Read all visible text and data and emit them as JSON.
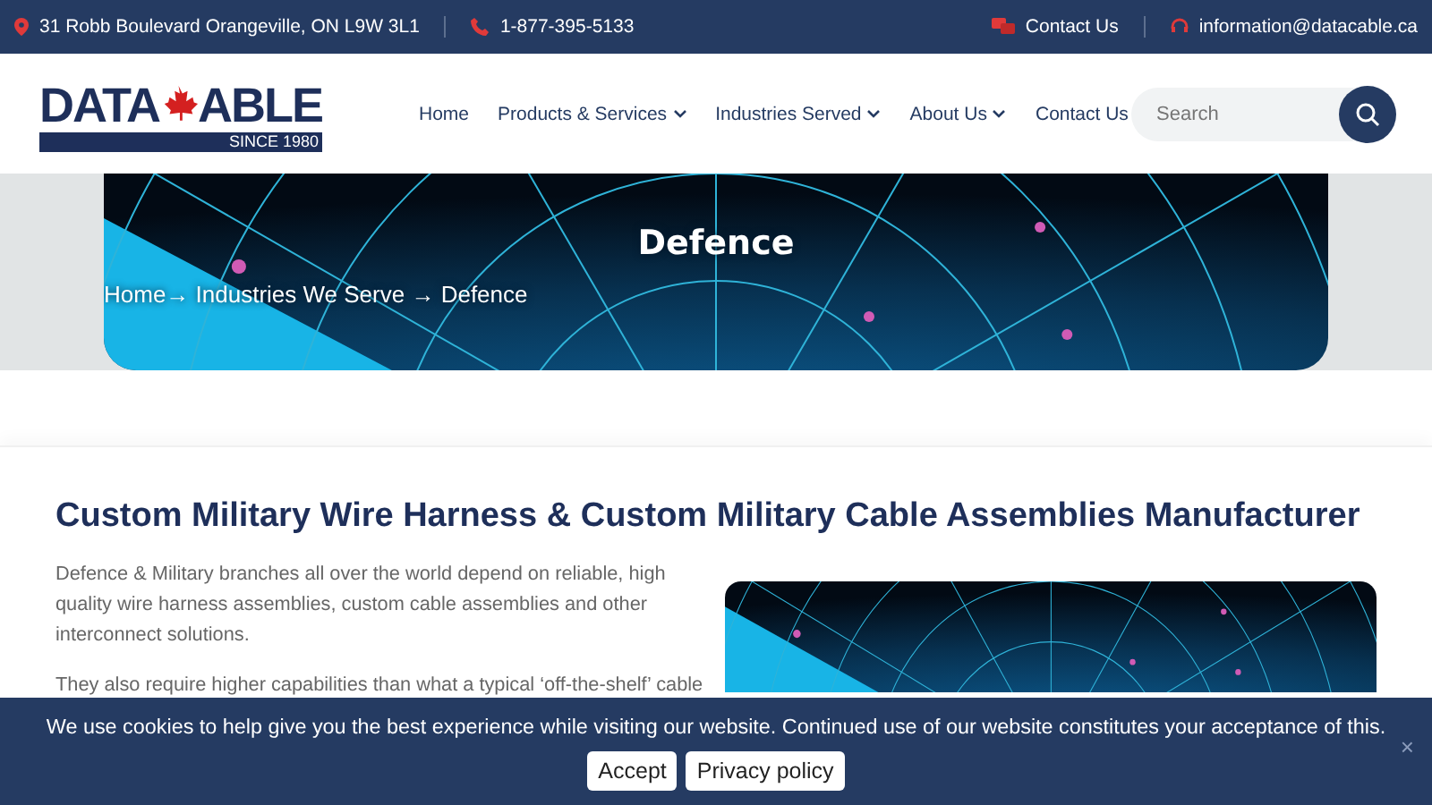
{
  "top_bar": {
    "address": "31 Robb Boulevard Orangeville, ON L9W 3L1",
    "phone": "1-877-395-5133",
    "contact": "Contact Us",
    "email": "information@datacable.ca"
  },
  "logo": {
    "left": "DATA",
    "right": "ABLE",
    "tagline": "SINCE 1980"
  },
  "nav": [
    {
      "label": "Home",
      "dropdown": false
    },
    {
      "label": "Products & Services",
      "dropdown": true
    },
    {
      "label": "Industries Served",
      "dropdown": true
    },
    {
      "label": "About Us",
      "dropdown": true
    },
    {
      "label": "Contact Us",
      "dropdown": false
    }
  ],
  "search": {
    "placeholder": "Search"
  },
  "hero": {
    "title": "Defence",
    "breadcrumb": "Home→ Industries We Serve → Defence"
  },
  "content": {
    "heading": "Custom Military Wire Harness & Custom Military Cable Assemblies Manufacturer",
    "paragraphs": [
      "Defence & Military branches all over the world depend on reliable, high quality wire harness assemblies, custom cable assemblies and other interconnect solutions.",
      "They also require higher capabilities than what a typical ‘off-the-shelf’ cable"
    ]
  },
  "cookie_bar": {
    "message": "We use cookies to help give you the best experience while visiting our website. Continued use of our website constitutes your acceptance of this.",
    "buttons": [
      "Accept",
      "Privacy policy"
    ],
    "close": "×"
  }
}
